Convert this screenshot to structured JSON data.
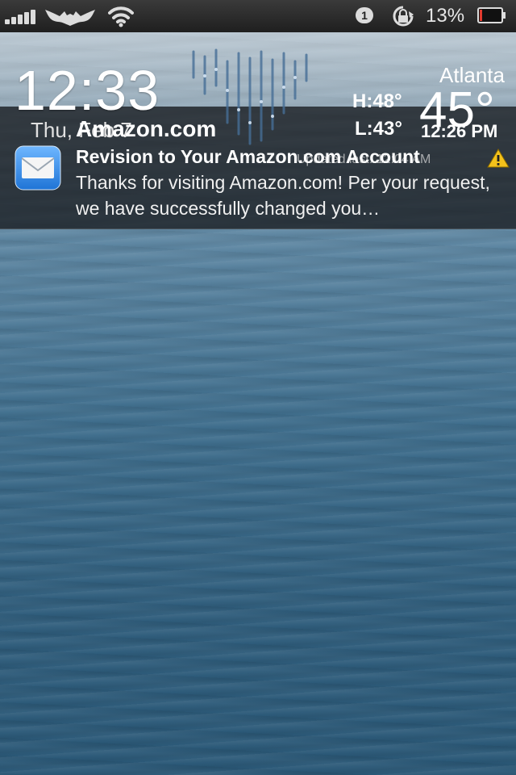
{
  "status_bar": {
    "signal_icon": "signal-bars-icon",
    "carrier_icon": "batman-logo-icon",
    "wifi_icon": "wifi-icon",
    "badge_count": "1",
    "rotation_lock_icon": "rotation-lock-icon",
    "battery_percent": "13%",
    "battery_level": 0.13,
    "battery_color": "#e03a2e"
  },
  "clock": {
    "time": "12:33",
    "date": "Thu, Feb 7"
  },
  "weather": {
    "city": "Atlanta",
    "high": "H:48°",
    "low": "L:43°",
    "temperature": "45°",
    "updated_time": "12:26 PM",
    "updated_note": "Updated last: 12:04 AM",
    "condition_icon": "rain-icon"
  },
  "notification": {
    "app_name": "Amazon.com",
    "app_icon": "mail-icon",
    "title": "Revision to Your Amazon.com Account",
    "alert_icon": "warning-icon",
    "body": "Thanks for visiting Amazon.com! Per your request, we have successfully changed you…"
  }
}
